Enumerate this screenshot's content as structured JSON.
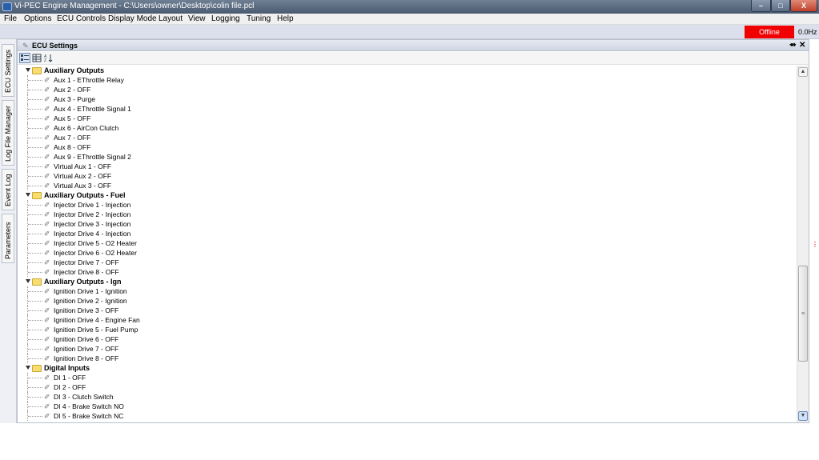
{
  "window": {
    "title": "Vi-PEC Engine Management - C:\\Users\\owner\\Desktop\\colin file.pcl"
  },
  "menu": [
    "File",
    "Options",
    "ECU Controls",
    "Display Mode",
    "Layout",
    "View",
    "Logging",
    "Tuning",
    "Help"
  ],
  "status": {
    "connection": "Offline",
    "connection_color": "#f00000",
    "rate": "0.0Hz"
  },
  "side_tabs": [
    "ECU Settings",
    "Log File Manager",
    "Event Log",
    "Parameters"
  ],
  "panel": {
    "title": "ECU Settings",
    "pin_icon": "pin-icon",
    "close_icon": "close-icon"
  },
  "tree": [
    {
      "type": "group",
      "label": "Auxiliary Outputs"
    },
    {
      "type": "item",
      "label": "Aux   1 - EThrottle Relay"
    },
    {
      "type": "item",
      "label": "Aux   2 - OFF"
    },
    {
      "type": "item",
      "label": "Aux   3 - Purge"
    },
    {
      "type": "item",
      "label": "Aux   4 - EThrottle Signal 1"
    },
    {
      "type": "item",
      "label": "Aux   5 - OFF"
    },
    {
      "type": "item",
      "label": "Aux   6 - AirCon Clutch"
    },
    {
      "type": "item",
      "label": "Aux   7 - OFF"
    },
    {
      "type": "item",
      "label": "Aux   8 - OFF"
    },
    {
      "type": "item",
      "label": "Aux   9 - EThrottle Signal 2"
    },
    {
      "type": "item",
      "label": "Virtual Aux  1 - OFF"
    },
    {
      "type": "item",
      "label": "Virtual Aux  2 - OFF"
    },
    {
      "type": "item",
      "label": "Virtual Aux  3 - OFF"
    },
    {
      "type": "group",
      "label": "Auxiliary Outputs - Fuel"
    },
    {
      "type": "item",
      "label": "Injector Drive 1 - Injection"
    },
    {
      "type": "item",
      "label": "Injector Drive 2 - Injection"
    },
    {
      "type": "item",
      "label": "Injector Drive 3 - Injection"
    },
    {
      "type": "item",
      "label": "Injector Drive 4 - Injection"
    },
    {
      "type": "item",
      "label": "Injector Drive 5 - O2 Heater"
    },
    {
      "type": "item",
      "label": "Injector Drive 6 - O2 Heater"
    },
    {
      "type": "item",
      "label": "Injector Drive 7 - OFF"
    },
    {
      "type": "item",
      "label": "Injector Drive 8 - OFF"
    },
    {
      "type": "group",
      "label": "Auxiliary Outputs - Ign"
    },
    {
      "type": "item",
      "label": "Ignition Drive 1 - Ignition"
    },
    {
      "type": "item",
      "label": "Ignition Drive 2 - Ignition"
    },
    {
      "type": "item",
      "label": "Ignition Drive 3 - OFF"
    },
    {
      "type": "item",
      "label": "Ignition Drive 4 - Engine Fan"
    },
    {
      "type": "item",
      "label": "Ignition Drive 5 - Fuel Pump"
    },
    {
      "type": "item",
      "label": "Ignition Drive 6 - OFF"
    },
    {
      "type": "item",
      "label": "Ignition Drive 7 - OFF"
    },
    {
      "type": "item",
      "label": "Ignition Drive 8 - OFF"
    },
    {
      "type": "group",
      "label": "Digital Inputs"
    },
    {
      "type": "item",
      "label": "DI  1 - OFF"
    },
    {
      "type": "item",
      "label": "DI  2 - OFF"
    },
    {
      "type": "item",
      "label": "DI  3 - Clutch Switch"
    },
    {
      "type": "item",
      "label": "DI  4 - Brake Switch NO"
    },
    {
      "type": "item",
      "label": "DI  5 - Brake Switch NC"
    }
  ]
}
